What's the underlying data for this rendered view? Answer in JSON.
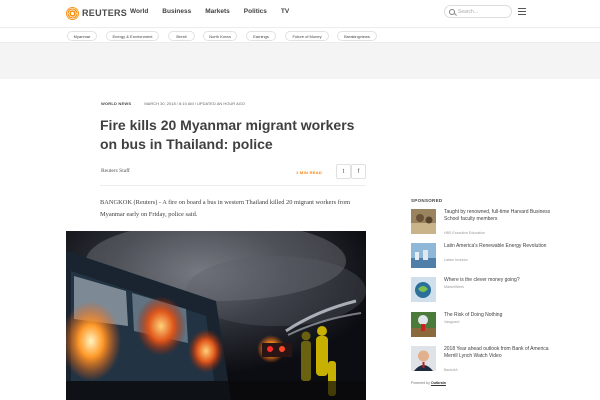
{
  "header": {
    "brand": "REUTERS",
    "nav": [
      "World",
      "Business",
      "Markets",
      "Politics",
      "TV"
    ],
    "search_placeholder": "Search..."
  },
  "topics": [
    "Myanmar",
    "Energy & Environment",
    "Brexit",
    "North Korea",
    "Earnings",
    "Future of Money",
    "Breakingviews"
  ],
  "article": {
    "section": "WORLD NEWS",
    "timestamp": "MARCH 30, 2018 / 8:10 AM / UPDATED AN HOUR AGO",
    "headline": "Fire kills 20 Myanmar migrant workers on bus in Thailand: police",
    "byline": "Reuters Staff",
    "read_time": "1 MIN READ",
    "lead": "BANGKOK (Reuters) - A fire on board a bus in western Thailand killed 20 migrant workers from Myanmar early on Friday, police said."
  },
  "share": {
    "twitter_glyph": "t",
    "facebook_glyph": "f"
  },
  "sponsored": {
    "label": "SPONSORED",
    "items": [
      {
        "title": "Taught by renowned, full-time Harvard Business School faculty members",
        "source": "HBS Executive Education"
      },
      {
        "title": "Latin America's Renewable Energy Revolution",
        "source": "Latam Investor"
      },
      {
        "title": "Where is the clever money going?",
        "source": "MarketWeek"
      },
      {
        "title": "The Risk of Doing Nothing",
        "source": "Vanguard"
      },
      {
        "title": "2018 Year ahead outlook from Bank of America Merrill Lynch Watch Video",
        "source": "BankofA"
      }
    ],
    "powered_prefix": "Powered by",
    "powered_brand": "Outbrain"
  },
  "colors": {
    "accent": "#ff8000",
    "text": "#404040",
    "ad_band": "#f4f4f4"
  }
}
